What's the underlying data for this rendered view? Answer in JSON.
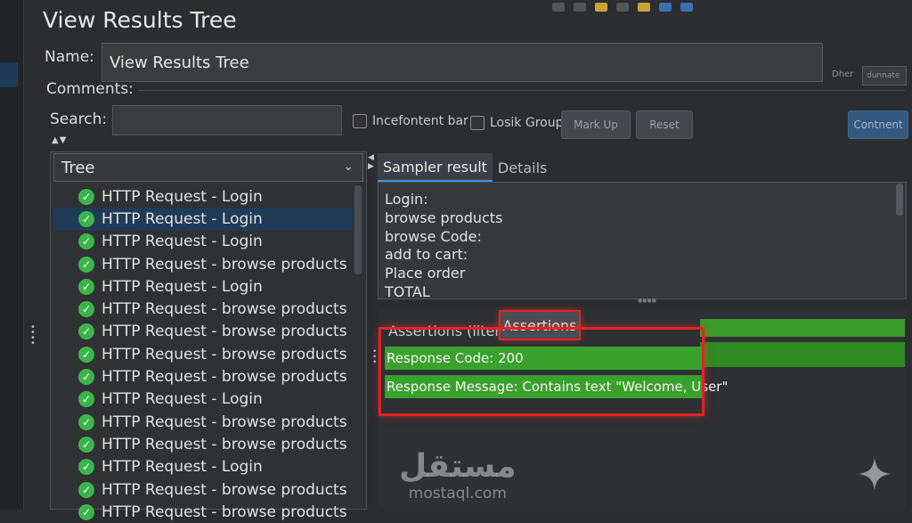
{
  "window": {
    "title": "View Results Tree"
  },
  "form": {
    "name_label": "Name:",
    "name_value": "View Results Tree",
    "comments_label": "Comments:",
    "search_label": "Search:",
    "search_value": "",
    "checkbox1_label": "Incefontent bar",
    "checkbox2_label": "Losik Group",
    "btn_markup": "Mark Up",
    "btn_reset": "Reset",
    "btn_blue": "Contnent",
    "filter_label": "Dher",
    "filter_value": "dunnate"
  },
  "tree": {
    "selector_label": "Tree",
    "items": [
      {
        "label": "HTTP Request - Login",
        "status": "success"
      },
      {
        "label": "HTTP Request - Login",
        "status": "success",
        "selected": true
      },
      {
        "label": "HTTP Request - Login",
        "status": "success"
      },
      {
        "label": "HTTP Request - browse products",
        "status": "success"
      },
      {
        "label": "HTTP Request - Login",
        "status": "success"
      },
      {
        "label": "HTTP Request - browse products",
        "status": "success"
      },
      {
        "label": "HTTP Request - browse products",
        "status": "success"
      },
      {
        "label": "HTTP Request - browse products",
        "status": "success"
      },
      {
        "label": "HTTP Request - browse products",
        "status": "success"
      },
      {
        "label": "HTTP Request - Login",
        "status": "success"
      },
      {
        "label": "HTTP Request - browse products",
        "status": "success"
      },
      {
        "label": "HTTP Request - browse products",
        "status": "success"
      },
      {
        "label": "HTTP Request - Login",
        "status": "success"
      },
      {
        "label": "HTTP Request - browse products",
        "status": "success"
      },
      {
        "label": "HTTP Request - browse products",
        "status": "success"
      }
    ]
  },
  "result_tabs": {
    "sampler": "Sampler result",
    "details": "Details"
  },
  "sampler_result": {
    "lines": [
      "Login:",
      "browse products",
      "browse Code:",
      "add to cart:",
      "Place order",
      "TOTAL"
    ]
  },
  "assertions": {
    "tab_filter": "Assertions (ilter)",
    "tab_active": "Assertions",
    "rows": [
      "Response Code: 200",
      "Response Message: Contains text \"Welcome, User\""
    ]
  },
  "watermark": {
    "arabic": "مستقل",
    "latin": "mostaql.com"
  },
  "colors": {
    "success": "#3bb54a",
    "assertion_green": "#3aa12c",
    "highlight_red": "#e02424",
    "selection": "#213a55"
  }
}
